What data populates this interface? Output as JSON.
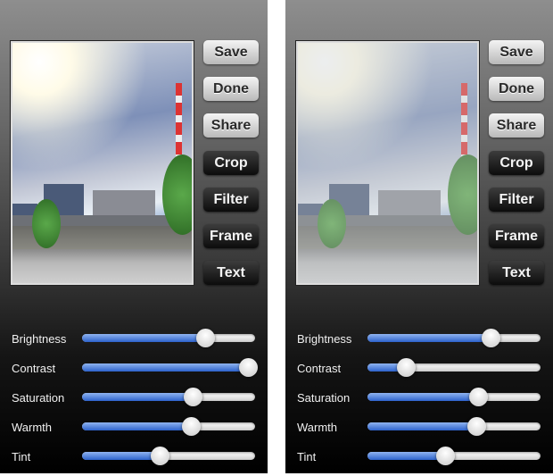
{
  "screens": [
    {
      "buttons": [
        "Save",
        "Done",
        "Share",
        "Crop",
        "Filter",
        "Frame",
        "Text"
      ],
      "sliders": [
        {
          "label": "Brightness",
          "value": 0.71
        },
        {
          "label": "Contrast",
          "value": 0.96
        },
        {
          "label": "Saturation",
          "value": 0.64
        },
        {
          "label": "Warmth",
          "value": 0.63
        },
        {
          "label": "Tint",
          "value": 0.45
        }
      ]
    },
    {
      "buttons": [
        "Save",
        "Done",
        "Share",
        "Crop",
        "Filter",
        "Frame",
        "Text"
      ],
      "sliders": [
        {
          "label": "Brightness",
          "value": 0.71
        },
        {
          "label": "Contrast",
          "value": 0.22
        },
        {
          "label": "Saturation",
          "value": 0.64
        },
        {
          "label": "Warmth",
          "value": 0.63
        },
        {
          "label": "Tint",
          "value": 0.45
        }
      ]
    }
  ],
  "colors": {
    "slider_fill": "#2c62cc",
    "button_light": "#d8d8d8",
    "button_dark": "#1e1e1e"
  }
}
